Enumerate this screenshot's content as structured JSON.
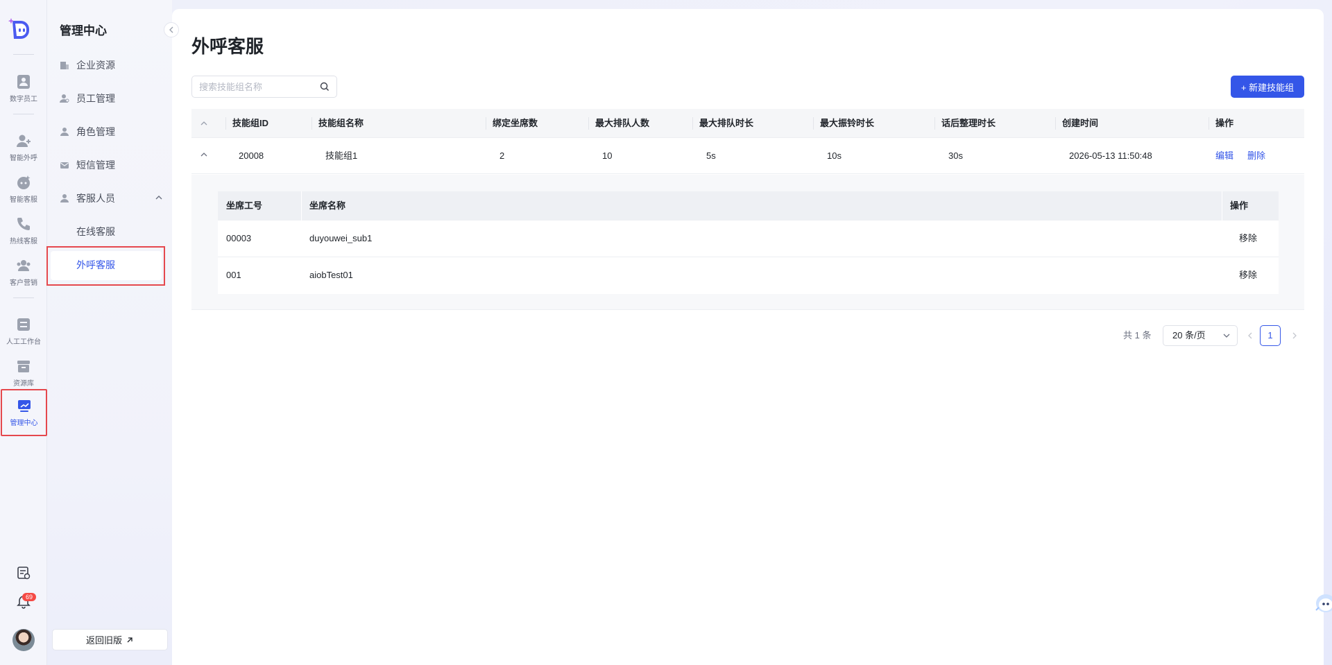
{
  "rail": {
    "items": [
      {
        "label": "数字员工",
        "icon": "digital-employee-icon"
      },
      {
        "label": "智能外呼",
        "icon": "smart-outbound-icon"
      },
      {
        "label": "智能客服",
        "icon": "smart-service-icon"
      },
      {
        "label": "热线客服",
        "icon": "hotline-icon"
      },
      {
        "label": "客户营销",
        "icon": "customer-marketing-icon"
      },
      {
        "label": "人工工作台",
        "icon": "workbench-icon"
      },
      {
        "label": "资源库",
        "icon": "resource-library-icon"
      },
      {
        "label": "管理中心",
        "icon": "management-center-icon",
        "active": true
      }
    ],
    "notification_count": "69"
  },
  "sidenav": {
    "title": "管理中心",
    "items": [
      {
        "label": "企业资源",
        "icon": "building-icon"
      },
      {
        "label": "员工管理",
        "icon": "employee-icon"
      },
      {
        "label": "角色管理",
        "icon": "role-icon"
      },
      {
        "label": "短信管理",
        "icon": "sms-icon"
      },
      {
        "label": "客服人员",
        "icon": "agent-icon",
        "expanded": true
      }
    ],
    "sub_items": [
      {
        "label": "在线客服"
      },
      {
        "label": "外呼客服",
        "active": true
      }
    ],
    "old_version_label": "返回旧版"
  },
  "main": {
    "title": "外呼客服",
    "search_placeholder": "搜索技能组名称",
    "new_button_label": "+ 新建技能组",
    "columns": [
      "技能组ID",
      "技能组名称",
      "绑定坐席数",
      "最大排队人数",
      "最大排队时长",
      "最大振铃时长",
      "话后整理时长",
      "创建时间",
      "操作"
    ],
    "rows": [
      {
        "id": "20008",
        "name": "技能组1",
        "seats": "2",
        "max_queue": "10",
        "max_queue_time": "5s",
        "max_ring_time": "10s",
        "wrap_up_time": "30s",
        "created": "2026-05-13 11:50:48",
        "edit_label": "编辑",
        "delete_label": "删除"
      }
    ],
    "sub_table": {
      "columns": [
        "坐席工号",
        "坐席名称",
        "操作"
      ],
      "rows": [
        {
          "agent_no": "00003",
          "agent_name": "duyouwei_sub1",
          "remove_label": "移除"
        },
        {
          "agent_no": "001",
          "agent_name": "aiobTest01",
          "remove_label": "移除"
        }
      ]
    },
    "pagination": {
      "total": "共 1 条",
      "page_size": "20 条/页",
      "current_page": "1"
    }
  },
  "colors": {
    "accent": "#3456e8",
    "highlight_border": "#e5484d",
    "badge": "#f54a45"
  }
}
